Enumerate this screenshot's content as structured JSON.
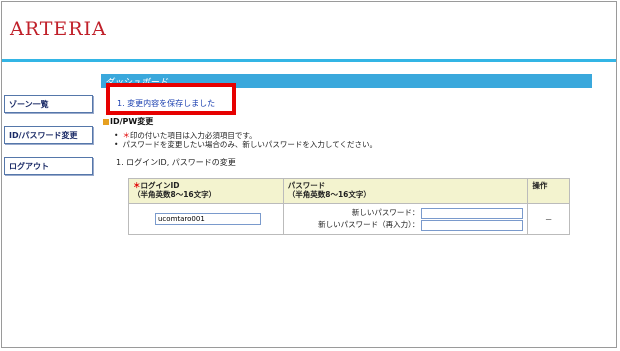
{
  "brand": {
    "logo_text": "ARTERIA"
  },
  "sidebar": {
    "items": [
      {
        "label": "ゾーン一覧"
      },
      {
        "label": "ID/パスワード変更"
      },
      {
        "label": "ログアウト"
      }
    ]
  },
  "main": {
    "title": "ダッシュボード",
    "saved_message": "1. 変更内容を保存しました",
    "section_title": "ID/PW変更",
    "notes": {
      "required_prefix": "＊",
      "required_text": "印の付いた項目は入力必須項目です。",
      "password_note": "パスワードを変更したい場合のみ、新しいパスワードを入力してください。"
    },
    "step_label": "1. ログインID, パスワードの変更"
  },
  "form": {
    "login_id_header": "ログインID",
    "login_id_sub": "（半角英数8～16文字）",
    "password_header": "パスワード",
    "password_sub": "（半角英数8～16文字）",
    "operation_header": "操作",
    "login_id_value": "ucomtaro001",
    "new_password_label": "新しいパスワード：",
    "confirm_password_label": "新しいパスワード（再入力）：",
    "operation_value": "－",
    "required_mark": "＊"
  },
  "colors": {
    "accent_blue": "#33b5e5",
    "title_bar": "#3aa8dc",
    "logo_red": "#c0202a",
    "highlight_red": "#e60000",
    "table_header": "#f3f3cf"
  }
}
